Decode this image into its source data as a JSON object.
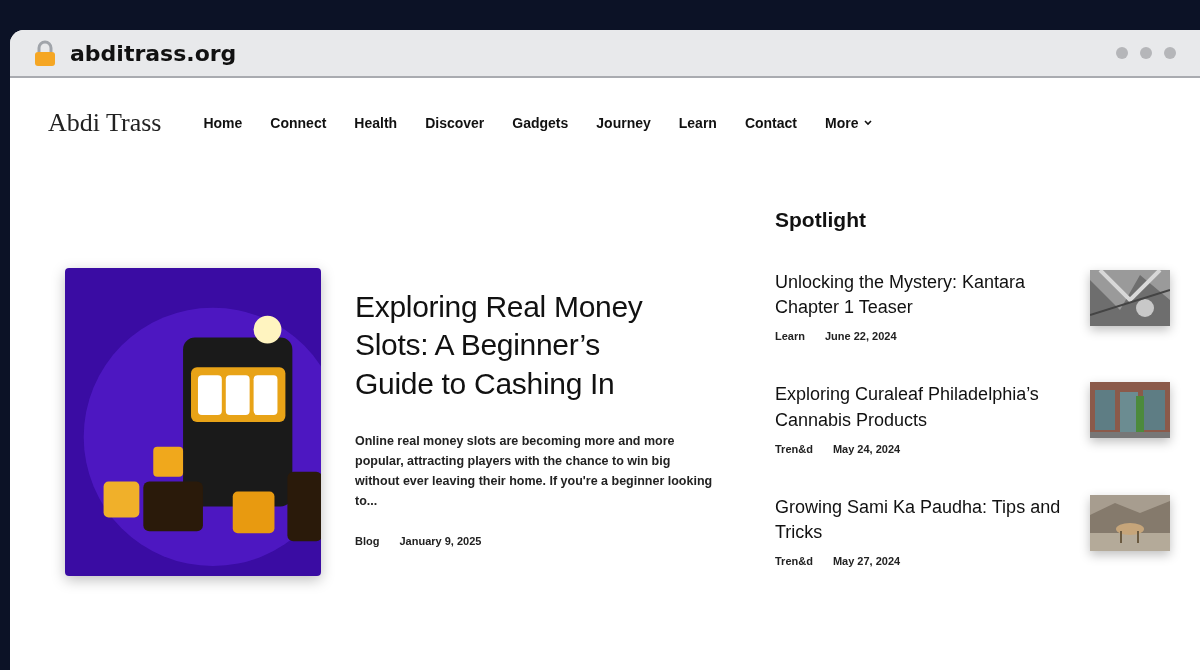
{
  "browser": {
    "url": "abditrass.org"
  },
  "site": {
    "logo": "Abdi Trass",
    "nav": [
      {
        "label": "Home"
      },
      {
        "label": "Connect"
      },
      {
        "label": "Health"
      },
      {
        "label": "Discover"
      },
      {
        "label": "Gadgets"
      },
      {
        "label": "Journey"
      },
      {
        "label": "Learn"
      },
      {
        "label": "Contact"
      },
      {
        "label": "More",
        "dropdown": true
      }
    ]
  },
  "featured": {
    "title": "Exploring Real Money Slots: A Beginner’s Guide to Cashing In",
    "excerpt": "Online real money slots are becoming more and more popular, attracting players with the chance to win big without ever leaving their home. If you're a beginner looking to...",
    "category": "Blog",
    "date": "January 9, 2025"
  },
  "spotlight": {
    "heading": "Spotlight",
    "items": [
      {
        "title": "Unlocking the Mystery: Kantara Chapter 1 Teaser",
        "category": "Learn",
        "date": "June 22, 2024"
      },
      {
        "title": "Exploring Curaleaf Philadelphia’s Cannabis Products",
        "category": "Tren&d",
        "date": "May 24, 2024"
      },
      {
        "title": "Growing Sami Ka Paudha: Tips and Tricks",
        "category": "Tren&d",
        "date": "May 27, 2024"
      }
    ]
  }
}
